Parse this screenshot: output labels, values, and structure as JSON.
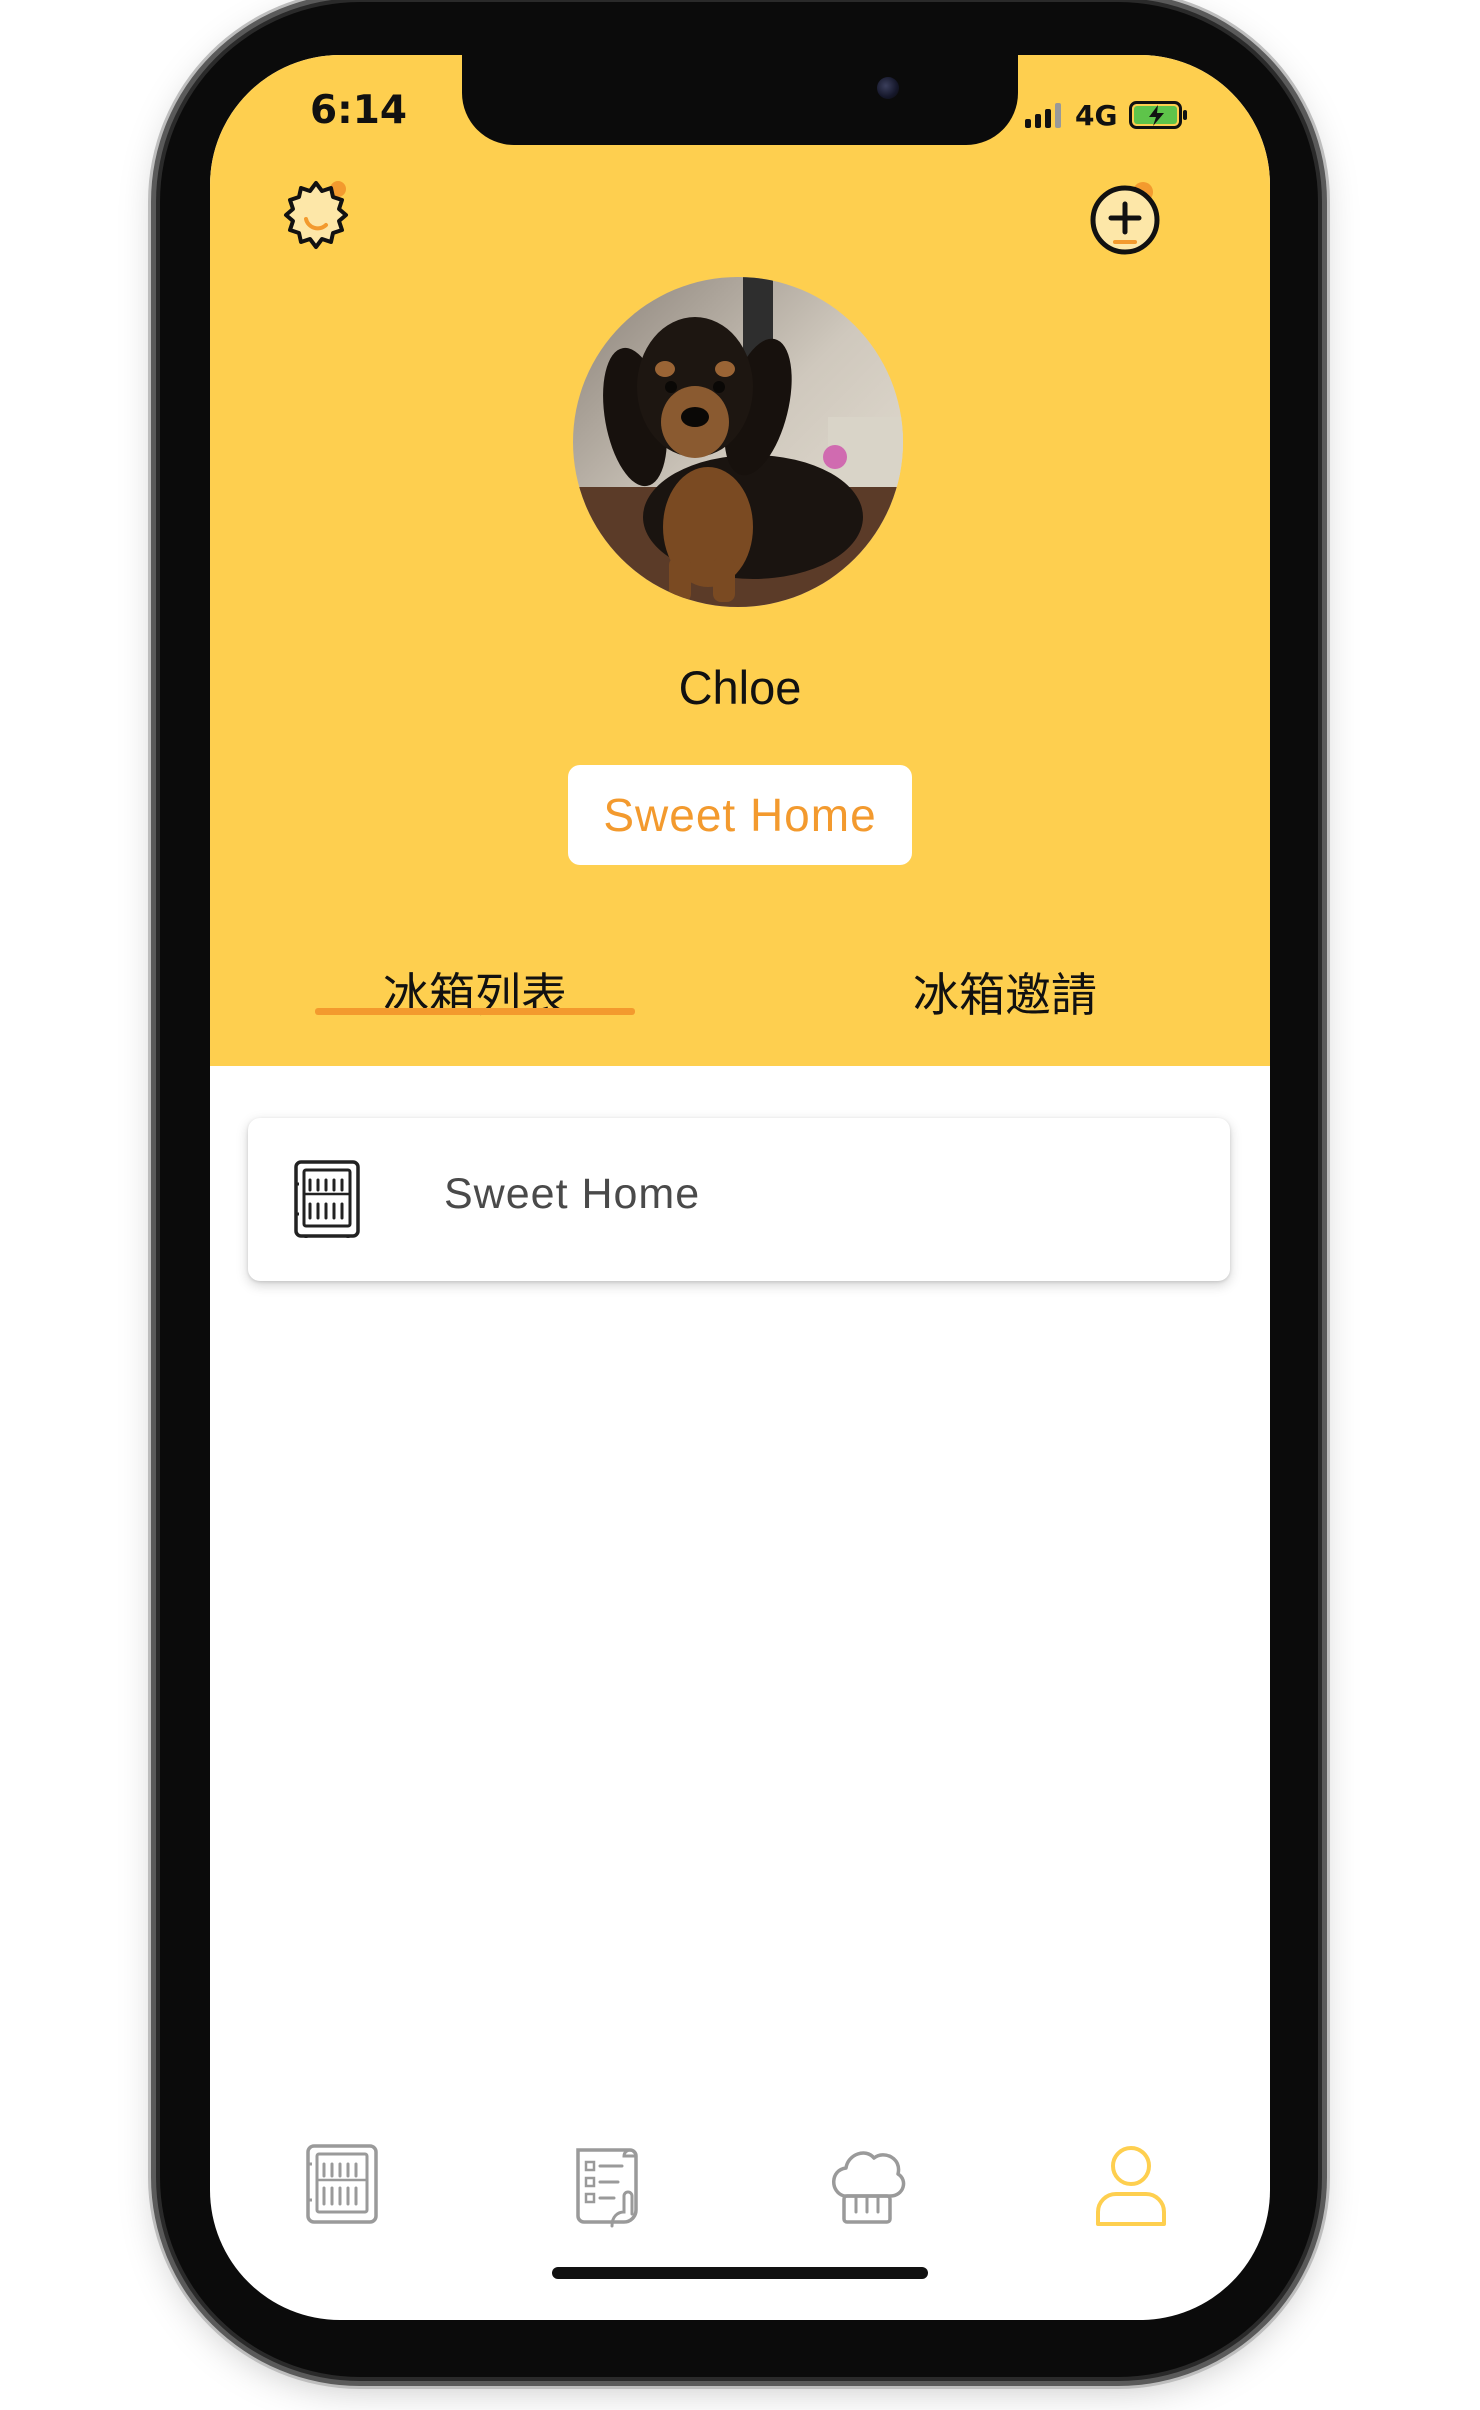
{
  "status_bar": {
    "time": "6:14",
    "network": "4G"
  },
  "header": {
    "settings_icon": "gear-icon",
    "add_icon": "plus-circle-icon",
    "background_color": "#fecf4f"
  },
  "profile": {
    "avatar_icon": "dog-photo",
    "name": "Chloe",
    "current_home": "Sweet Home"
  },
  "tabs": [
    {
      "label": "冰箱列表",
      "active": true
    },
    {
      "label": "冰箱邀請",
      "active": false
    }
  ],
  "fridges": [
    {
      "icon": "fridge-icon",
      "name": "Sweet Home"
    }
  ],
  "bottom_nav": [
    {
      "icon": "fridge-icon",
      "active": false
    },
    {
      "icon": "checklist-icon",
      "active": false
    },
    {
      "icon": "chef-hat-icon",
      "active": false
    },
    {
      "icon": "user-icon",
      "active": true
    }
  ],
  "colors": {
    "accent": "#f39a2e",
    "header": "#fecf4f",
    "active_nav": "#fecf4f",
    "inactive_nav": "#9a9a9a"
  }
}
